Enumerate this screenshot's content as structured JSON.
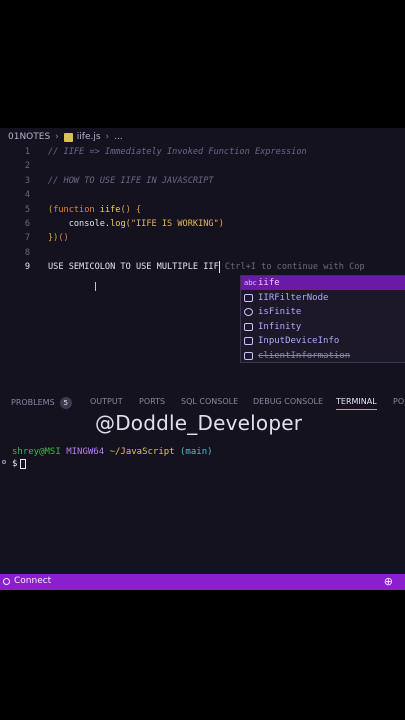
{
  "breadcrumb": {
    "folder": "01NOTES",
    "file": "iife.js",
    "ellipsis": "..."
  },
  "editor": {
    "lines": [
      {
        "n": "1",
        "segments": [
          {
            "t": "// IIFE => Immediately Invoked Function Expression",
            "c": "comment"
          }
        ]
      },
      {
        "n": "2",
        "segments": []
      },
      {
        "n": "3",
        "segments": [
          {
            "t": "// HOW TO USE IIFE IN JAVASCRIPT",
            "c": "comment"
          }
        ]
      },
      {
        "n": "4",
        "segments": []
      },
      {
        "n": "5",
        "segments": [
          {
            "t": "(",
            "c": "punc"
          },
          {
            "t": "function ",
            "c": "kw"
          },
          {
            "t": "iife",
            "c": "fn"
          },
          {
            "t": "() {",
            "c": "punc"
          }
        ]
      },
      {
        "n": "6",
        "segments": [
          {
            "t": "    console",
            "c": "plain"
          },
          {
            "t": ".",
            "c": "plain"
          },
          {
            "t": "log",
            "c": "fn"
          },
          {
            "t": "(\"IIFE IS WORKING\")",
            "c": "str"
          }
        ]
      },
      {
        "n": "7",
        "segments": [
          {
            "t": "})",
            "c": "punc"
          },
          {
            "t": "()",
            "c": "kw"
          }
        ]
      },
      {
        "n": "8",
        "segments": []
      },
      {
        "n": "9",
        "segments": [
          {
            "t": "USE SEMICOLON TO USE MULTIPLE IIF",
            "c": "plain"
          },
          {
            "t": "",
            "c": "caret"
          },
          {
            "t": " Ctrl+I to continue with Cop",
            "c": "ghost"
          }
        ]
      }
    ],
    "active_line": "9"
  },
  "suggestions": [
    {
      "icon": "abc",
      "icon_name": "text-suggestion-icon",
      "label": "iife",
      "selected": true,
      "strike": false
    },
    {
      "icon": "[ ]",
      "icon_name": "variable-icon",
      "label": "IIRFilterNode",
      "selected": false,
      "strike": false
    },
    {
      "icon": "⬡",
      "icon_name": "method-cube-icon",
      "label": "isFinite",
      "selected": false,
      "strike": false
    },
    {
      "icon": "[ ]",
      "icon_name": "variable-icon",
      "label": "Infinity",
      "selected": false,
      "strike": false
    },
    {
      "icon": "[ ]",
      "icon_name": "variable-icon",
      "label": "InputDeviceInfo",
      "selected": false,
      "strike": false
    },
    {
      "icon": "[ ]",
      "icon_name": "variable-icon",
      "label": "clientInformation",
      "selected": false,
      "strike": true
    }
  ],
  "panel_tabs": [
    {
      "label": "PROBLEMS",
      "badge": "5",
      "active": false
    },
    {
      "label": "OUTPUT",
      "active": false
    },
    {
      "label": "PORTS",
      "active": false
    },
    {
      "label": "SQL CONSOLE",
      "active": false
    },
    {
      "label": "DEBUG CONSOLE",
      "active": false
    },
    {
      "label": "TERMINAL",
      "active": true
    },
    {
      "label": "PO",
      "active": false
    }
  ],
  "watermark": "@Doddle_Developer",
  "terminal": {
    "user_host": "shrey@MSI",
    "shell": "MINGW64",
    "path": "~/JavaScript",
    "branch": "(main)",
    "prompt": "$"
  },
  "statusbar": {
    "remote_label": "Connect",
    "zoom_icon": "zoom-icon"
  },
  "colors": {
    "statusbar": "#8a1fcf",
    "selected_suggestion": "#6a1aa6",
    "editor_bg": "#15121f"
  }
}
